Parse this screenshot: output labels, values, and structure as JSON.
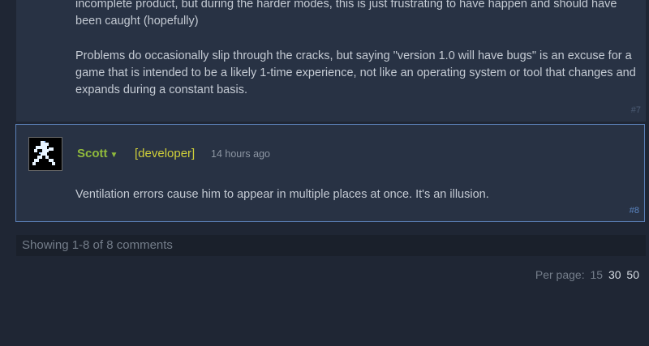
{
  "previous_comment": {
    "paragraph_1": "incomplete product, but during the harder modes, this is just frustrating to have happen and should have been caught (hopefully)",
    "paragraph_2": "Problems do occasionally slip through the cracks, but saying \"version 1.0 will have bugs\" is an excuse for a game that is intended to be a likely 1-time experience, not like an operating system or tool that changes and expands during a constant basis.",
    "number": "#7"
  },
  "developer_comment": {
    "author": "Scott",
    "author_caret": "▼",
    "tag": "[developer]",
    "time": "14 hours ago",
    "text": "Ventilation errors cause him to appear in multiple places at once. It's an illusion.",
    "number": "#8"
  },
  "pagination": {
    "showing": "Showing 1-8 of 8 comments",
    "per_page_label": "Per page:",
    "options": [
      "15",
      "30",
      "50"
    ],
    "active": [
      "30",
      "50"
    ]
  },
  "colors": {
    "author": "#90ba3c",
    "developer_tag": "#d0d03a",
    "highlight_border": "#5c81b8"
  }
}
